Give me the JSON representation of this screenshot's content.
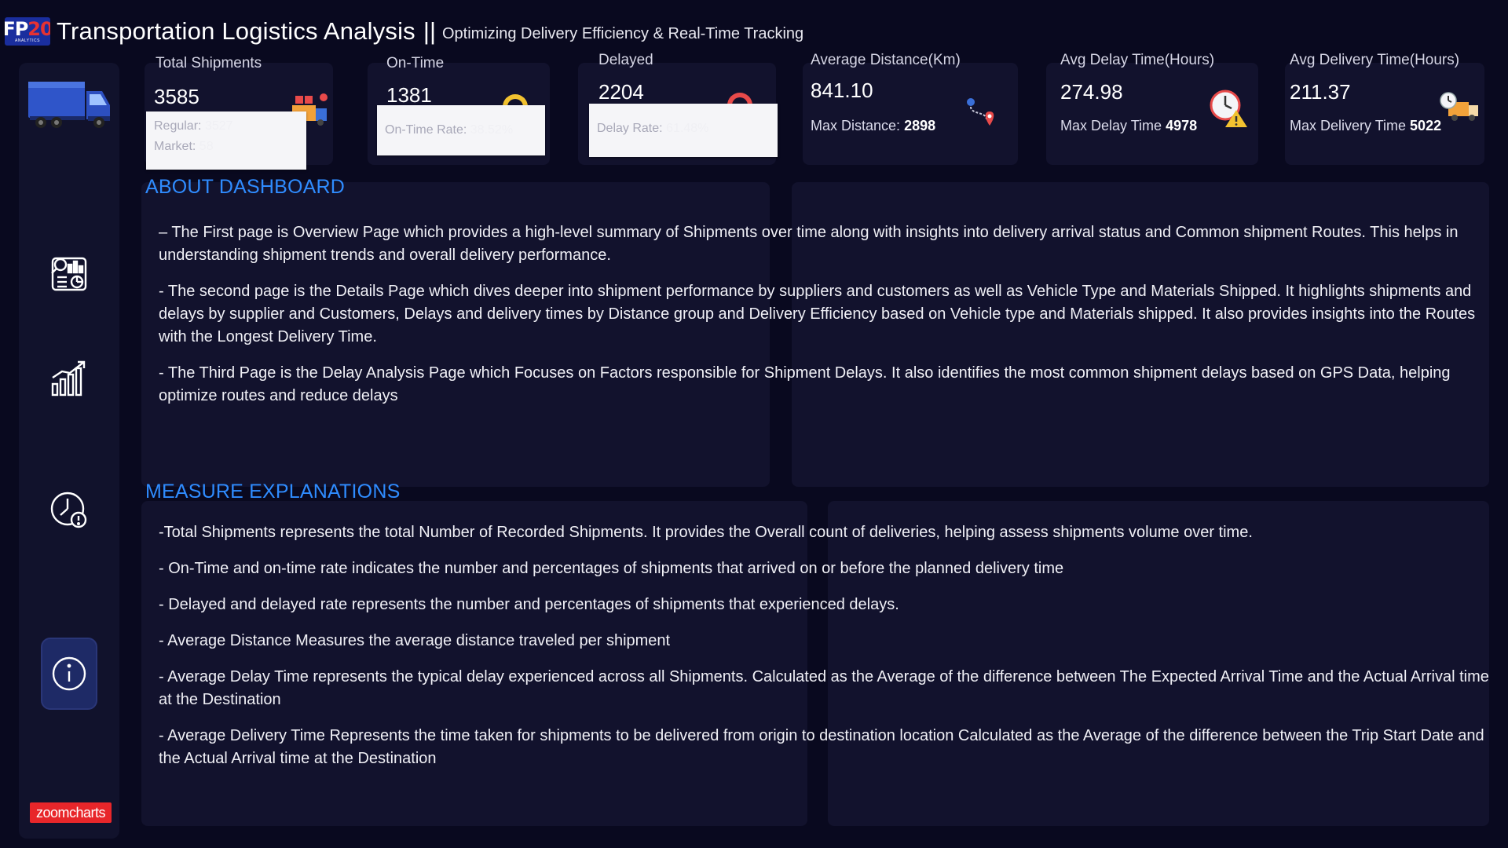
{
  "header": {
    "logo_top": "FP",
    "logo_accent": "20",
    "logo_sub": "ANALYTICS",
    "title": "Transportation Logistics Analysis",
    "separator": "||",
    "subtitle": "Optimizing Delivery Efficiency & Real-Time Tracking"
  },
  "sidebar": {
    "items": [
      {
        "name": "overview-page",
        "icon": "dashboard-search-icon"
      },
      {
        "name": "details-page",
        "icon": "bar-chart-growth-icon"
      },
      {
        "name": "delay-analysis-page",
        "icon": "clock-alert-icon"
      },
      {
        "name": "info-page",
        "icon": "info-icon",
        "active": true
      }
    ],
    "brand": "zoomcharts"
  },
  "kpis": {
    "total_shipments": {
      "label": "Total Shipments",
      "value": "3585",
      "tip_regular_label": "Regular:",
      "tip_regular_value": "3527",
      "tip_market_label": "Market:",
      "tip_market_value": "58"
    },
    "on_time": {
      "label": "On-Time",
      "value": "1381",
      "tip_label": "On-Time Rate:",
      "tip_value": "38.52%"
    },
    "delayed": {
      "label": "Delayed",
      "value": "2204",
      "tip_label": "Delay Rate:",
      "tip_value": "61.48%"
    },
    "avg_distance": {
      "label": "Average Distance(Km)",
      "value": "841.10",
      "sub_label": "Max Distance:",
      "sub_value": "2898"
    },
    "avg_delay": {
      "label": "Avg Delay Time(Hours)",
      "value": "274.98",
      "sub_label": "Max Delay Time",
      "sub_value": "4978"
    },
    "avg_delivery": {
      "label": "Avg Delivery Time(Hours)",
      "value": "211.37",
      "sub_label": "Max Delivery Time",
      "sub_value": "5022"
    }
  },
  "about": {
    "title": "ABOUT DASHBOARD",
    "paragraphs": [
      "– The First page is Overview Page which provides a high-level summary of Shipments over time along with insights into delivery arrival status and Common shipment Routes. This helps in understanding shipment trends and overall delivery performance.",
      "- The second page is the Details Page which dives deeper into shipment performance by suppliers and customers as well as Vehicle Type and Materials Shipped. It highlights shipments and delays by supplier and Customers, Delays and delivery times  by Distance group and Delivery Efficiency based on Vehicle type and Materials shipped. It also provides insights into the Routes with the Longest Delivery Time.",
      "- The Third Page is the Delay Analysis Page which Focuses on Factors responsible for Shipment Delays.  It also identifies the most common shipment delays based on GPS Data, helping optimize routes and reduce delays"
    ]
  },
  "measures": {
    "title": "MEASURE EXPLANATIONS",
    "paragraphs": [
      "-Total Shipments represents the total Number of Recorded Shipments. It provides the Overall count of deliveries, helping assess shipments volume over time.",
      "- On-Time and on-time rate indicates the number  and percentages of shipments that arrived on or before the planned delivery time",
      "- Delayed and delayed rate represents the number and percentages  of shipments that experienced delays.",
      "- Average Distance Measures the average distance traveled per shipment",
      "- Average Delay Time represents the typical delay experienced across all Shipments. Calculated as the Average of the difference between The Expected Arrival Time and the Actual Arrival time at the Destination",
      "- Average Delivery Time Represents the time taken for shipments to be delivered from origin to destination location Calculated as the Average of the difference between the Trip Start Date and the Actual Arrival time at the Destination"
    ]
  },
  "colors": {
    "background": "#09091f",
    "panel": "#12122d",
    "accent_blue": "#2f8cff",
    "brand_red": "#e8262a"
  }
}
